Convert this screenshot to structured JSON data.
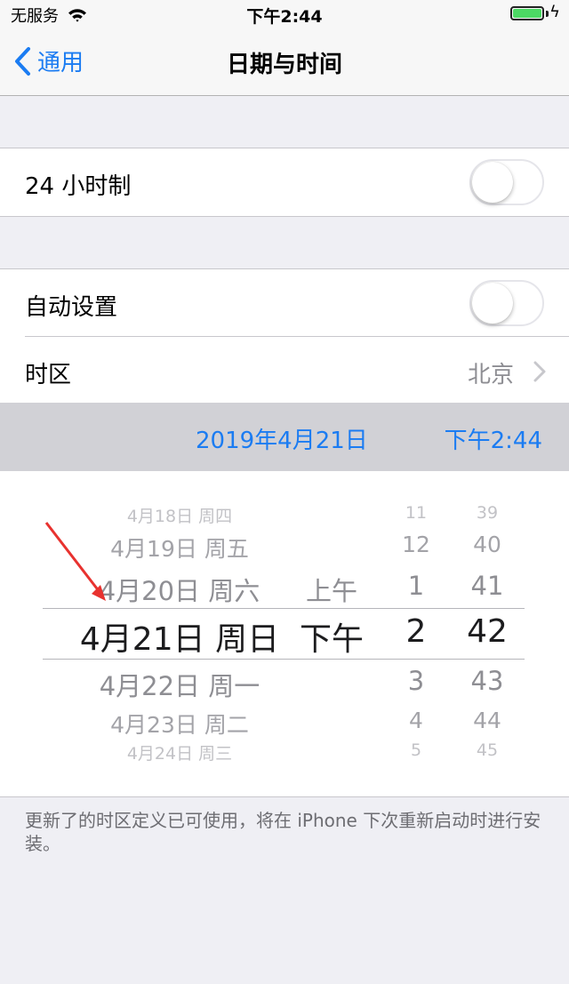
{
  "status_bar": {
    "carrier": "无服务",
    "time": "下午2:44",
    "icons": [
      "wifi-icon",
      "battery-icon",
      "charging-icon"
    ]
  },
  "nav": {
    "back_label": "通用",
    "title": "日期与时间"
  },
  "settings": {
    "twenty_four_hour": {
      "label": "24 小时制",
      "enabled": false
    },
    "auto_set": {
      "label": "自动设置",
      "enabled": false
    },
    "time_zone": {
      "label": "时区",
      "value": "北京"
    }
  },
  "selected": {
    "date": "2019年4月21日",
    "time": "下午2:44"
  },
  "picker": {
    "rows": [
      {
        "date": "4月18日 周四",
        "ampm": "",
        "hour": "11",
        "minute": "39"
      },
      {
        "date": "4月19日 周五",
        "ampm": "",
        "hour": "12",
        "minute": "40"
      },
      {
        "date": "4月20日 周六",
        "ampm": "上午",
        "hour": "1",
        "minute": "41"
      },
      {
        "date": "4月21日 周日",
        "ampm": "下午",
        "hour": "2",
        "minute": "42"
      },
      {
        "date": "4月22日 周一",
        "ampm": "",
        "hour": "3",
        "minute": "43"
      },
      {
        "date": "4月23日 周二",
        "ampm": "",
        "hour": "4",
        "minute": "44"
      },
      {
        "date": "4月24日 周三",
        "ampm": "",
        "hour": "5",
        "minute": "45"
      }
    ],
    "selected_index": 3
  },
  "footer_note": "更新了的时区定义已可使用，将在 iPhone 下次重新启动时进行安装。",
  "colors": {
    "accent": "#1b7cf2",
    "annotation_arrow": "#e8322f",
    "battery": "#4cd964"
  }
}
